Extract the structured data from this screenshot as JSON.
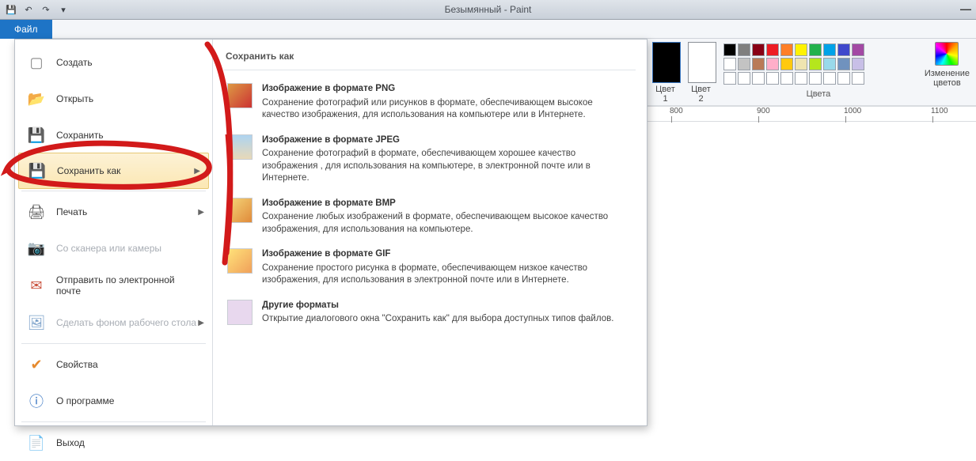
{
  "window": {
    "title": "Безымянный - Paint",
    "minimize": "—"
  },
  "tabs": {
    "file": "Файл"
  },
  "file_menu": {
    "items": [
      {
        "label": "Создать",
        "icon": "new"
      },
      {
        "label": "Открыть",
        "icon": "open"
      },
      {
        "label": "Сохранить",
        "icon": "save"
      },
      {
        "label": "Сохранить как",
        "icon": "saveas",
        "arrow": true,
        "highlight": true
      },
      {
        "label": "Печать",
        "icon": "print",
        "arrow": true
      },
      {
        "label": "Со сканера или камеры",
        "icon": "scan",
        "disabled": true
      },
      {
        "label": "Отправить по электронной почте",
        "icon": "mail"
      },
      {
        "label": "Сделать фоном рабочего стола",
        "icon": "desk",
        "arrow": true,
        "disabled": true
      },
      {
        "label": "Свойства",
        "icon": "prop"
      },
      {
        "label": "О программе",
        "icon": "about"
      },
      {
        "label": "Выход",
        "icon": "exit"
      }
    ],
    "submenu_title": "Сохранить как",
    "formats": [
      {
        "title": "Изображение в формате PNG",
        "desc": "Сохранение фотографий или рисунков в формате, обеспечивающем высокое качество изображения, для использования на компьютере или в Интернете.",
        "bg": "linear-gradient(135deg,#d94,#c33)"
      },
      {
        "title": "Изображение в формате JPEG",
        "desc": "Сохранение фотографий в формате, обеспечивающем хорошее качество изображения , для использования на компьютере, в электронной почте или в Интернете.",
        "bg": "linear-gradient(180deg,#aed4f0,#e8d9b8)"
      },
      {
        "title": "Изображение в формате BMP",
        "desc": "Сохранение любых изображений в формате, обеспечивающем высокое качество изображения, для использования на компьютере.",
        "bg": "linear-gradient(135deg,#f5d77a,#e08a3a)"
      },
      {
        "title": "Изображение в формате GIF",
        "desc": "Сохранение простого рисунка в формате, обеспечивающем низкое качество изображения, для использования в электронной почте или в Интернете.",
        "bg": "linear-gradient(135deg,#ffe27a,#f0a05a)"
      },
      {
        "title": "Другие форматы",
        "desc": "Открытие диалогового окна \"Сохранить как\" для выбора доступных типов файлов.",
        "bg": "#e8d8ee"
      }
    ]
  },
  "colors": {
    "c1_label": "Цвет\n1",
    "c2_label": "Цвет\n2",
    "group_label": "Цвета",
    "edit_label": "Изменение\nцветов",
    "row1": [
      "#000000",
      "#7f7f7f",
      "#880015",
      "#ed1c24",
      "#ff7f27",
      "#fff200",
      "#22b14c",
      "#00a2e8",
      "#3f48cc",
      "#a349a4"
    ],
    "row2": [
      "#ffffff",
      "#c3c3c3",
      "#b97a57",
      "#ffaec9",
      "#ffc90e",
      "#efe4b0",
      "#b5e61d",
      "#99d9ea",
      "#7092be",
      "#c8bfe7"
    ],
    "row3": [
      "#ffffff",
      "#ffffff",
      "#ffffff",
      "#ffffff",
      "#ffffff",
      "#ffffff",
      "#ffffff",
      "#ffffff",
      "#ffffff",
      "#ffffff"
    ]
  },
  "ruler": {
    "ticks": [
      800,
      900,
      1000,
      1100
    ]
  }
}
